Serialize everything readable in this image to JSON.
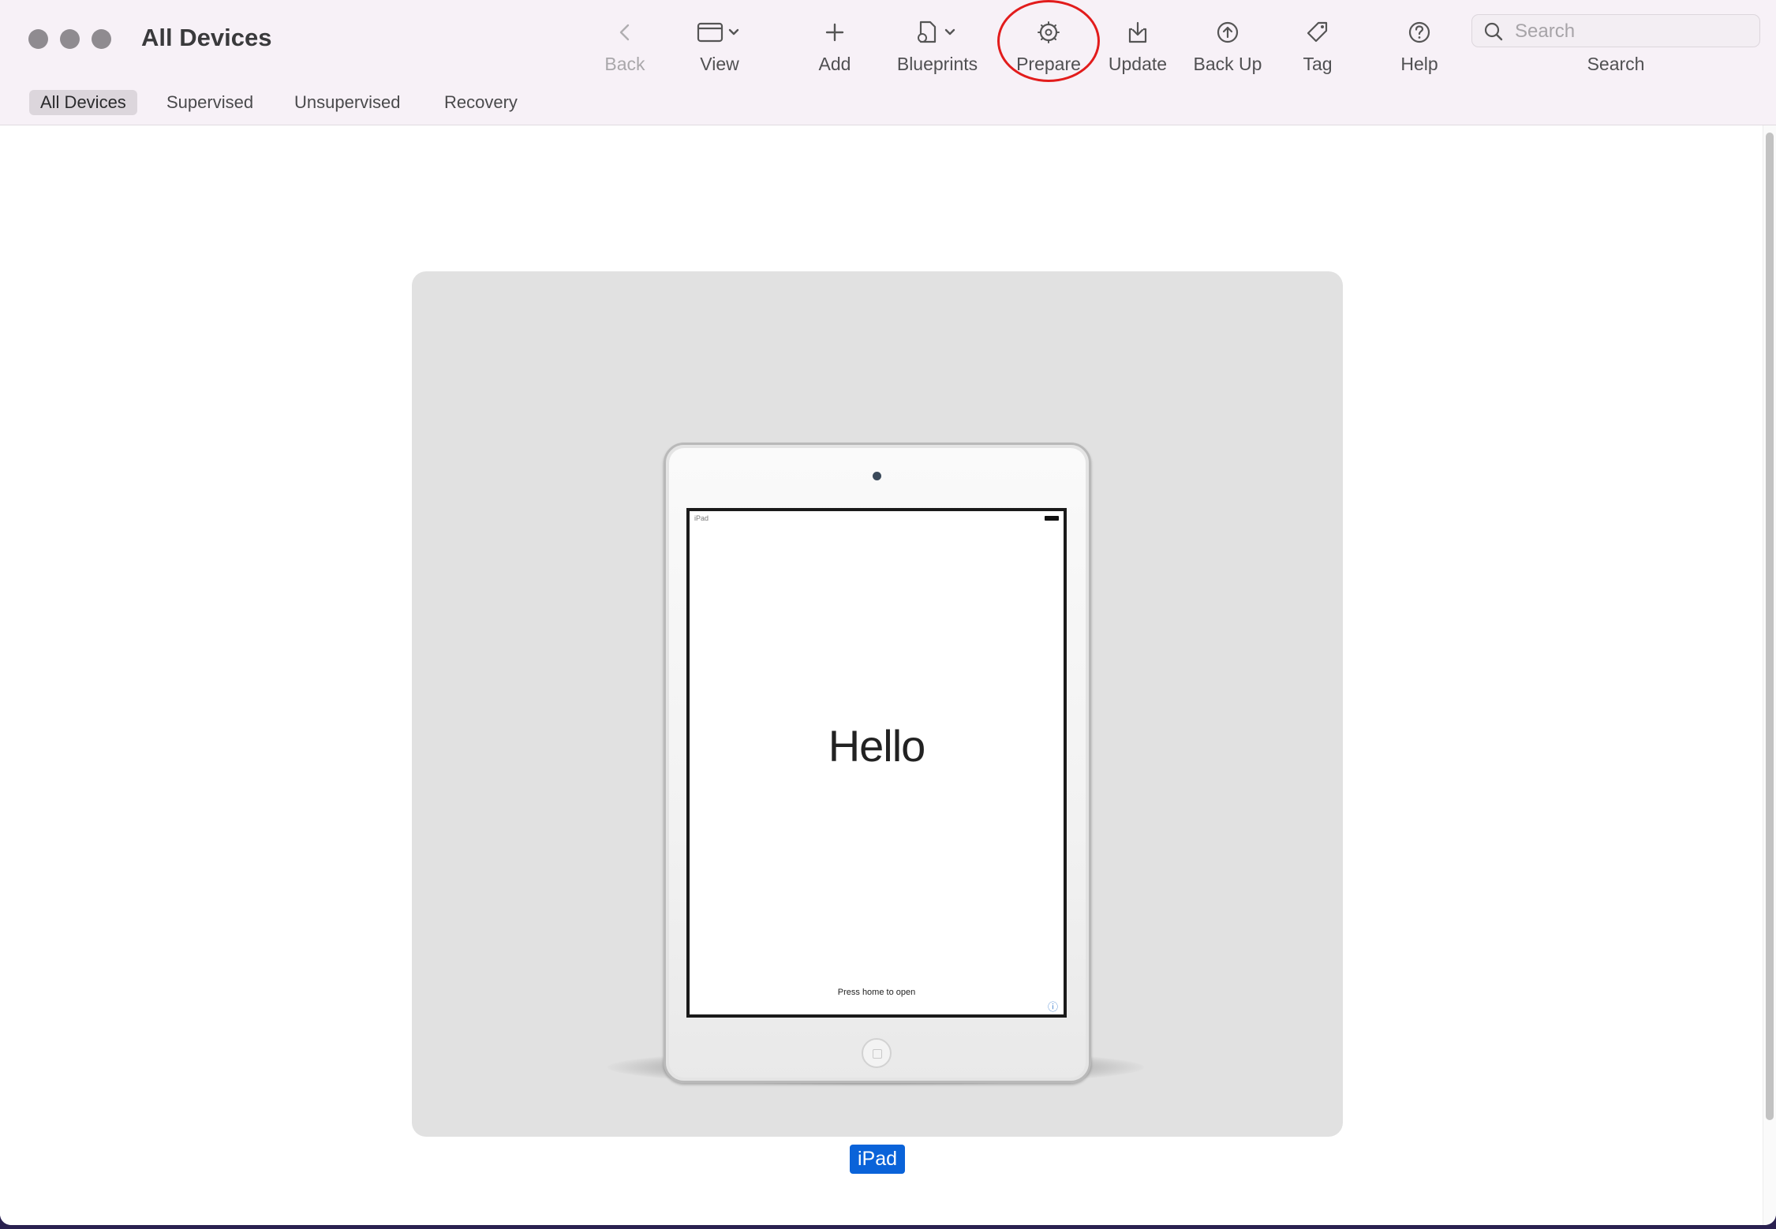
{
  "window": {
    "title": "All Devices"
  },
  "toolbar": {
    "items": [
      {
        "label": "Back",
        "icon": "chevron-left-icon",
        "enabled": false
      },
      {
        "label": "View",
        "icon": "window-view-icon",
        "has_menu": true
      },
      {
        "label": "Add",
        "icon": "plus-icon"
      },
      {
        "label": "Blueprints",
        "icon": "blueprint-document-icon",
        "has_menu": true
      },
      {
        "label": "Prepare",
        "icon": "gear-prepare-icon",
        "highlighted": true
      },
      {
        "label": "Update",
        "icon": "download-tray-icon"
      },
      {
        "label": "Back Up",
        "icon": "upload-circle-icon"
      },
      {
        "label": "Tag",
        "icon": "tag-icon"
      },
      {
        "label": "Help",
        "icon": "question-circle-icon"
      }
    ],
    "search": {
      "placeholder": "Search",
      "label": "Search"
    }
  },
  "filters": {
    "tabs": [
      "All Devices",
      "Supervised",
      "Unsupervised",
      "Recovery"
    ],
    "selected": "All Devices"
  },
  "devices": [
    {
      "name": "iPad",
      "selected": true,
      "screen": {
        "carrier": "iPad",
        "greeting": "Hello",
        "prompt": "Press home to open"
      }
    }
  ],
  "colors": {
    "accent": "#0a63d9",
    "highlight_circle": "#e21c1c",
    "toolbar_bg": "#f7f1f7"
  }
}
